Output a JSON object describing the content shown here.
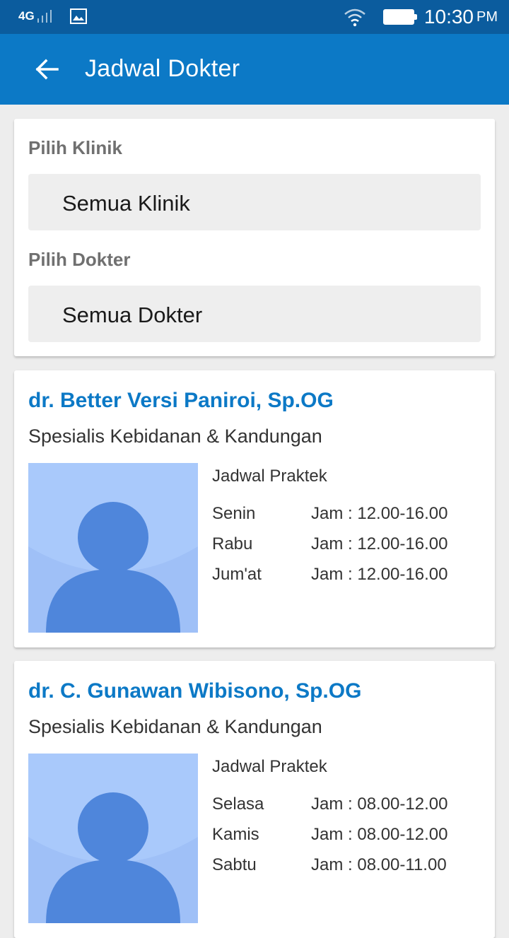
{
  "status_bar": {
    "network": "4G",
    "time": "10:30",
    "ampm": "PM"
  },
  "app_bar": {
    "title": "Jadwal Dokter"
  },
  "filters": {
    "clinic_label": "Pilih Klinik",
    "clinic_value": "Semua Klinik",
    "doctor_label": "Pilih Dokter",
    "doctor_value": "Semua Dokter"
  },
  "doctors": [
    {
      "name": "dr. Better Versi Paniroi, Sp.OG",
      "specialty": "Spesialis Kebidanan & Kandungan",
      "schedule_title": "Jadwal Praktek",
      "schedule": [
        {
          "day": "Senin",
          "time": "Jam : 12.00-16.00"
        },
        {
          "day": "Rabu",
          "time": "Jam : 12.00-16.00"
        },
        {
          "day": "Jum'at",
          "time": "Jam : 12.00-16.00"
        }
      ]
    },
    {
      "name": "dr. C. Gunawan Wibisono, Sp.OG",
      "specialty": "Spesialis Kebidanan & Kandungan",
      "schedule_title": "Jadwal Praktek",
      "schedule": [
        {
          "day": "Selasa",
          "time": "Jam : 08.00-12.00"
        },
        {
          "day": "Kamis",
          "time": "Jam : 08.00-12.00"
        },
        {
          "day": "Sabtu",
          "time": "Jam : 08.00-11.00"
        }
      ]
    }
  ],
  "colors": {
    "status_bar": "#0b5c9e",
    "app_bar": "#0c79c6",
    "doctor_name": "#0c79c6",
    "avatar_bg": "#a9c9fb",
    "avatar_fg": "#4f86db"
  }
}
